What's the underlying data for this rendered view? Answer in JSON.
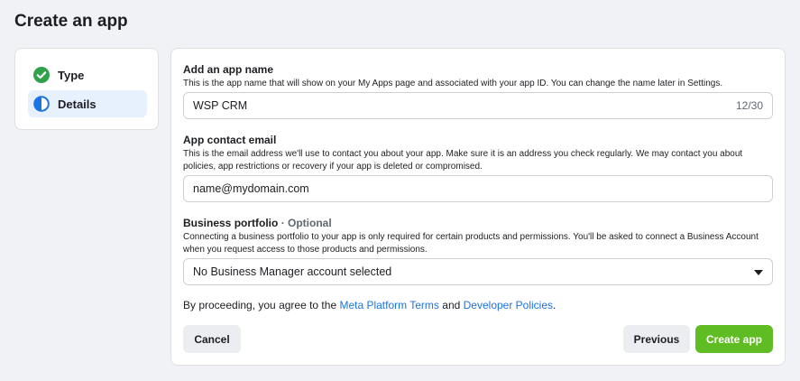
{
  "page": {
    "title": "Create an app"
  },
  "steps": [
    {
      "label": "Type",
      "icon": "check-circle-icon",
      "status": "complete"
    },
    {
      "label": "Details",
      "icon": "half-circle-icon",
      "status": "current"
    }
  ],
  "form": {
    "app_name": {
      "label": "Add an app name",
      "help": "This is the app name that will show on your My Apps page and associated with your app ID. You can change the name later in Settings.",
      "value": "WSP CRM",
      "counter": "12/30"
    },
    "contact_email": {
      "label": "App contact email",
      "help": "This is the email address we'll use to contact you about your app. Make sure it is an address you check regularly. We may contact you about policies, app restrictions or recovery if your app is deleted or compromised.",
      "value": "name@mydomain.com"
    },
    "business_portfolio": {
      "label": "Business portfolio",
      "optional": "· Optional",
      "help": "Connecting a business portfolio to your app is only required for certain products and permissions. You'll be asked to connect a Business Account when you request access to those products and permissions.",
      "selected": "No Business Manager account selected"
    },
    "agreement": {
      "prefix": "By proceeding, you agree to the ",
      "link1": "Meta Platform Terms",
      "middle": " and ",
      "link2": "Developer Policies",
      "suffix": "."
    }
  },
  "buttons": {
    "cancel": "Cancel",
    "previous": "Previous",
    "create": "Create app"
  },
  "colors": {
    "primary_link": "#1b74e4",
    "create_button": "#5fbc23",
    "step_selected_bg": "#e7f0fd",
    "check_green": "#31a24c"
  }
}
